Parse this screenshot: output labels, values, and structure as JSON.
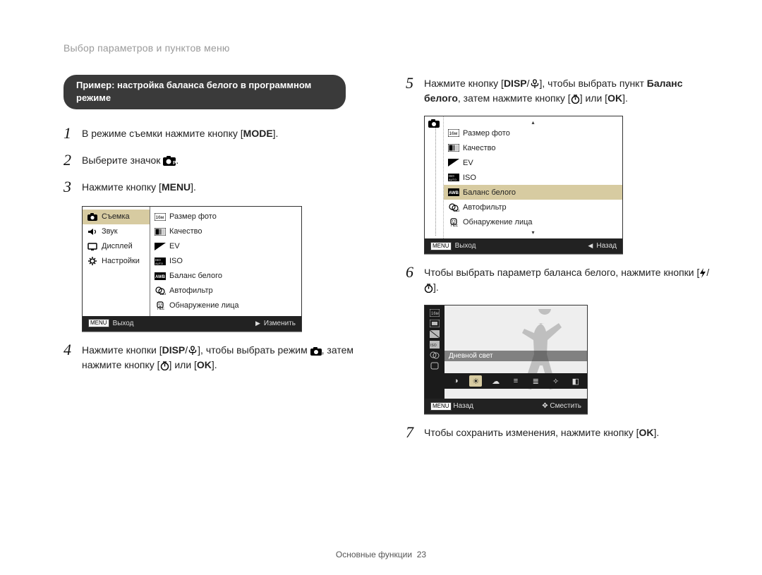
{
  "header": "Выбор параметров и пунктов меню",
  "example_title": "Пример: настройка баланса белого в программном режиме",
  "steps_left": {
    "s1": {
      "num": "1",
      "pre": "В режиме съемки нажмите кнопку [",
      "btn": "MODE",
      "post": "]."
    },
    "s2": {
      "num": "2",
      "pre": "Выберите значок ",
      "post": "."
    },
    "s3": {
      "num": "3",
      "pre": "Нажмите кнопку [",
      "btn": "MENU",
      "post": "]."
    },
    "s4": {
      "num": "4",
      "pre": "Нажмите кнопки [",
      "btn_a": "DISP",
      "mid_a": "/",
      "mid_b": "], чтобы выбрать режим ",
      "post_a": ", затем нажмите кнопку [",
      "post_b": "] или [",
      "btn_ok": "OK",
      "post_c": "]."
    }
  },
  "steps_right": {
    "s5": {
      "num": "5",
      "pre": "Нажмите кнопку [",
      "btn_a": "DISP",
      "mid_a": "/",
      "mid_b": "], чтобы выбрать пункт ",
      "bold": "Баланс белого",
      "post_a": ", затем нажмите кнопку [",
      "post_b": "] или [",
      "btn_ok": "OK",
      "post_c": "]."
    },
    "s6": {
      "num": "6",
      "pre": "Чтобы выбрать параметр баланса белого, нажмите кнопки [",
      "mid": "/",
      "post": "]."
    },
    "s7": {
      "num": "7",
      "pre": "Чтобы сохранить изменения, нажмите кнопку [",
      "btn_ok": "OK",
      "post": "]."
    }
  },
  "panel1": {
    "side": [
      {
        "label": "Съемка",
        "selected": true,
        "icon": "camera"
      },
      {
        "label": "Звук",
        "selected": false,
        "icon": "sound"
      },
      {
        "label": "Дисплей",
        "selected": false,
        "icon": "display"
      },
      {
        "label": "Настройки",
        "selected": false,
        "icon": "gear"
      }
    ],
    "main": [
      {
        "label": "Размер фото",
        "icon": "16m"
      },
      {
        "label": "Качество",
        "icon": "quality"
      },
      {
        "label": "EV",
        "icon": "ev"
      },
      {
        "label": "ISO",
        "icon": "iso"
      },
      {
        "label": "Баланс белого",
        "icon": "awb"
      },
      {
        "label": "Автофильтр",
        "icon": "filter"
      },
      {
        "label": "Обнаружение лица",
        "icon": "face"
      }
    ],
    "footer_left_icon": "MENU",
    "footer_left": "Выход",
    "footer_right_icon": "▶",
    "footer_right": "Изменить"
  },
  "panel2": {
    "main": [
      {
        "label": "Размер фото",
        "icon": "16m",
        "selected": false
      },
      {
        "label": "Качество",
        "icon": "quality",
        "selected": false
      },
      {
        "label": "EV",
        "icon": "ev",
        "selected": false
      },
      {
        "label": "ISO",
        "icon": "iso",
        "selected": false
      },
      {
        "label": "Баланс белого",
        "icon": "awb",
        "selected": true
      },
      {
        "label": "Автофильтр",
        "icon": "filter",
        "selected": false
      },
      {
        "label": "Обнаружение лица",
        "icon": "face",
        "selected": false
      }
    ],
    "footer_left_icon": "MENU",
    "footer_left": "Выход",
    "footer_right_icon": "◀",
    "footer_right": "Назад"
  },
  "panel3": {
    "label": "Дневной свет",
    "footer_left_icon": "MENU",
    "footer_left": "Назад",
    "footer_right": "Сместить"
  },
  "buttons": {
    "mode": "MODE",
    "menu": "MENU",
    "ok": "OK",
    "disp": "DISP"
  },
  "footer": {
    "section": "Основные функции",
    "page": "23"
  }
}
